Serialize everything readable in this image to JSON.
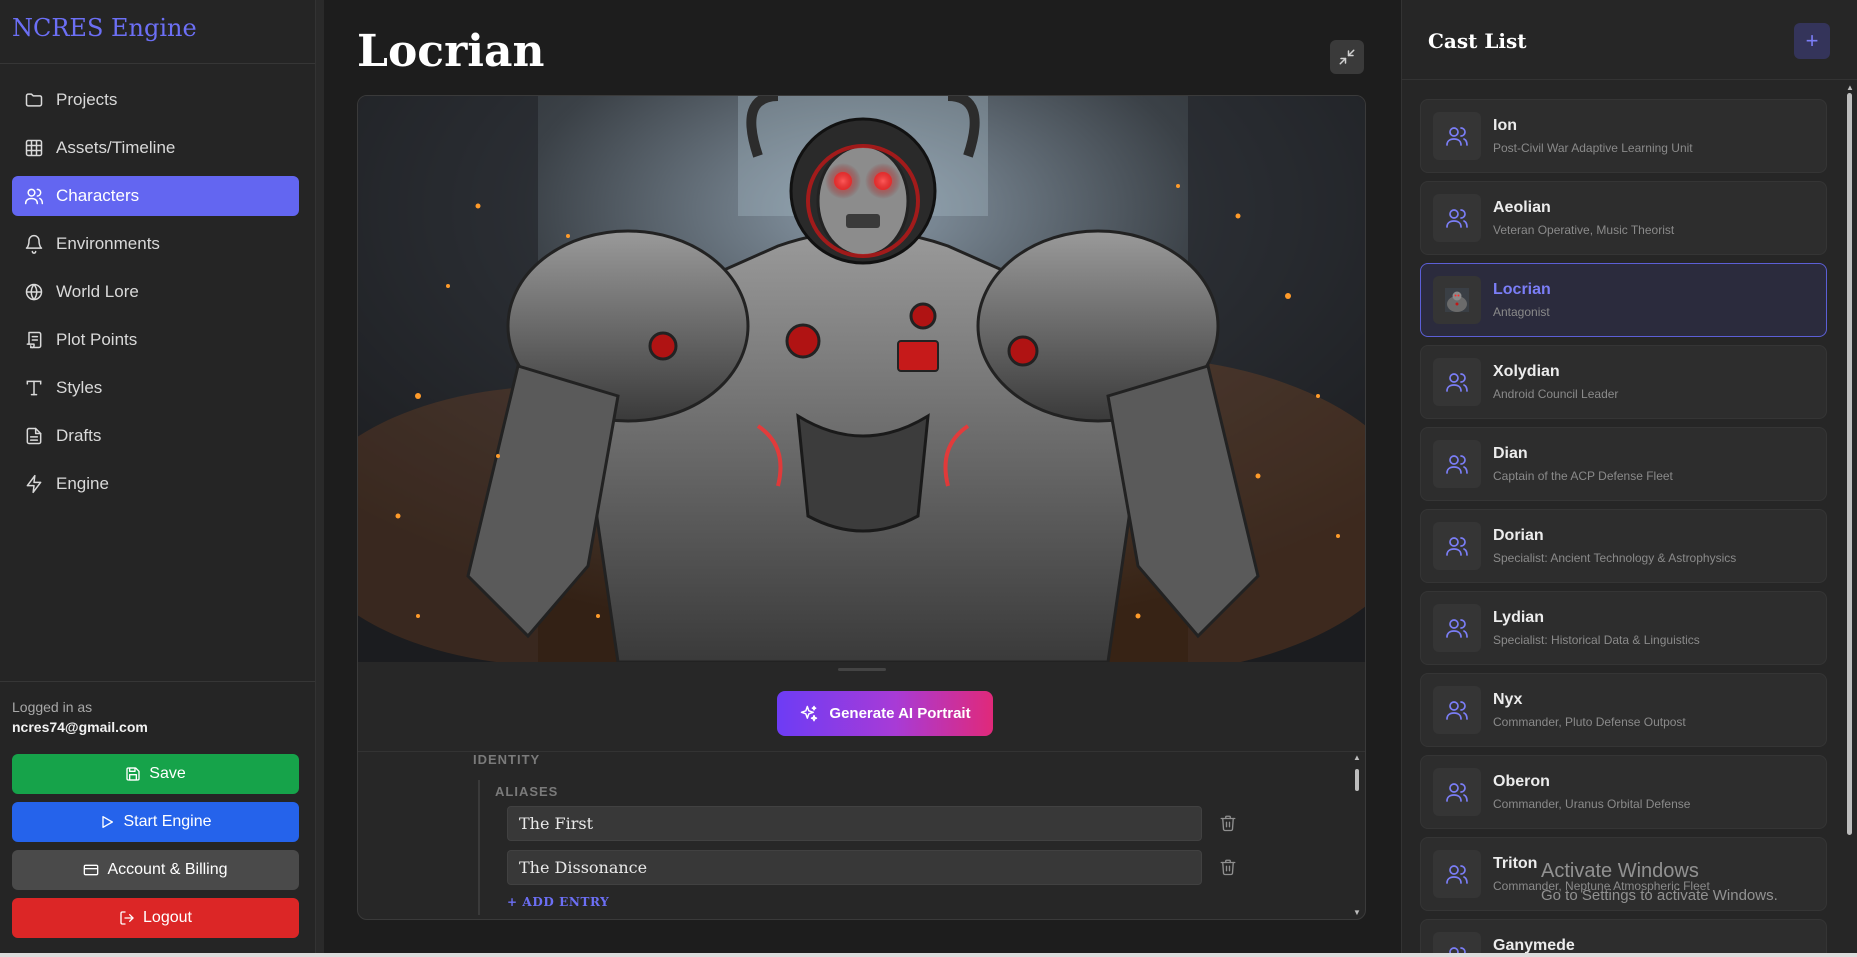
{
  "app": {
    "brand": "NCRES Engine"
  },
  "sidebar": {
    "items": [
      {
        "label": "Projects",
        "icon": "folder-icon"
      },
      {
        "label": "Assets/Timeline",
        "icon": "grid-icon"
      },
      {
        "label": "Characters",
        "icon": "users-icon",
        "active": true
      },
      {
        "label": "Environments",
        "icon": "bell-icon"
      },
      {
        "label": "World Lore",
        "icon": "globe-icon"
      },
      {
        "label": "Plot Points",
        "icon": "scroll-icon"
      },
      {
        "label": "Styles",
        "icon": "type-icon"
      },
      {
        "label": "Drafts",
        "icon": "file-text-icon"
      },
      {
        "label": "Engine",
        "icon": "zap-icon"
      }
    ],
    "logged_in_label": "Logged in as",
    "email": "ncres74@gmail.com",
    "save_label": "Save",
    "start_label": "Start Engine",
    "account_label": "Account & Billing",
    "logout_label": "Logout"
  },
  "main": {
    "character_name": "Locrian",
    "generate_label": "Generate AI Portrait",
    "section_identity": "IDENTITY",
    "section_aliases": "ALIASES",
    "aliases": [
      "The First",
      "The Dissonance"
    ],
    "add_entry_label": "+ ADD ENTRY"
  },
  "cast": {
    "title": "Cast List",
    "add_label": "+",
    "items": [
      {
        "name": "Ion",
        "role": "Post-Civil War Adaptive Learning Unit"
      },
      {
        "name": "Aeolian",
        "role": "Veteran Operative, Music Theorist"
      },
      {
        "name": "Locrian",
        "role": "Antagonist",
        "active": true
      },
      {
        "name": "Xolydian",
        "role": "Android Council Leader"
      },
      {
        "name": "Dian",
        "role": "Captain of the ACP Defense Fleet"
      },
      {
        "name": "Dorian",
        "role": "Specialist: Ancient Technology & Astrophysics"
      },
      {
        "name": "Lydian",
        "role": "Specialist: Historical Data & Linguistics"
      },
      {
        "name": "Nyx",
        "role": "Commander, Pluto Defense Outpost"
      },
      {
        "name": "Oberon",
        "role": "Commander, Uranus Orbital Defense"
      },
      {
        "name": "Triton",
        "role": "Commander, Neptune Atmospheric Fleet"
      },
      {
        "name": "Ganymede",
        "role": ""
      }
    ]
  },
  "watermark": {
    "line1": "Activate Windows",
    "line2": "Go to Settings to activate Windows."
  },
  "colors": {
    "accent": "#6366f1",
    "save": "#16a34a",
    "start": "#2563eb",
    "account": "#4a4a4a",
    "logout": "#dc2626"
  }
}
